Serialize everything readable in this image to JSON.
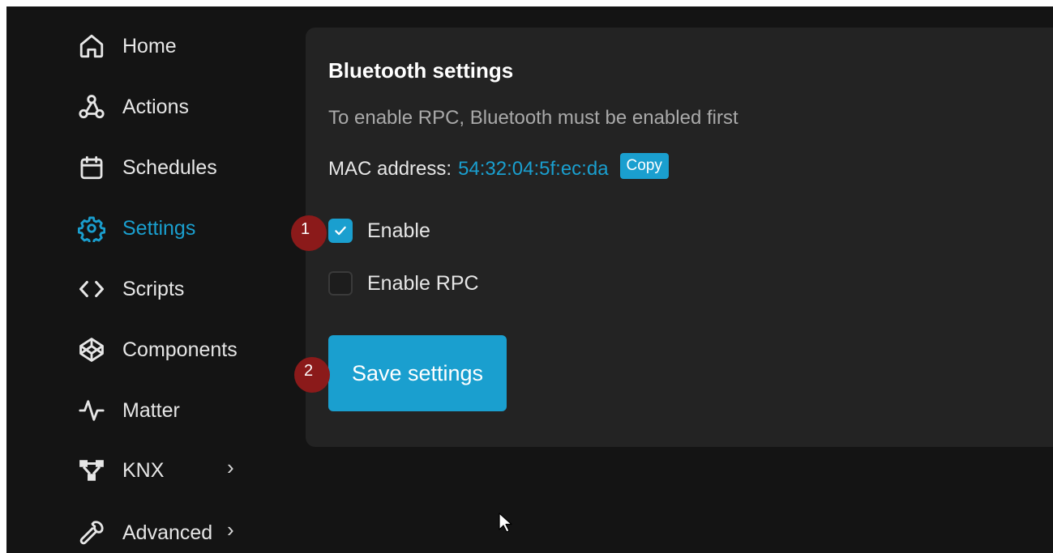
{
  "sidebar": {
    "items": [
      {
        "label": "Home",
        "icon": "home-icon"
      },
      {
        "label": "Actions",
        "icon": "webhook-icon"
      },
      {
        "label": "Schedules",
        "icon": "calendar-icon"
      },
      {
        "label": "Settings",
        "icon": "gear-icon",
        "active": true
      },
      {
        "label": "Scripts",
        "icon": "code-icon"
      },
      {
        "label": "Components",
        "icon": "codepen-icon"
      },
      {
        "label": "Matter",
        "icon": "pulse-icon"
      },
      {
        "label": "KNX",
        "icon": "network-icon",
        "has_submenu": true
      },
      {
        "label": "Advanced",
        "icon": "wrench-icon",
        "has_submenu": true
      }
    ]
  },
  "card": {
    "title": "Bluetooth settings",
    "description": "To enable RPC, Bluetooth must be enabled first",
    "mac_label": "MAC address:",
    "mac_value": "54:32:04:5f:ec:da",
    "copy_label": "Copy",
    "checkboxes": [
      {
        "label": "Enable",
        "checked": true
      },
      {
        "label": "Enable RPC",
        "checked": false
      }
    ],
    "save_label": "Save settings"
  },
  "annotations": {
    "badge_1": "1",
    "badge_2": "2"
  },
  "colors": {
    "accent": "#1a9fcf",
    "background": "#141414",
    "card": "#232323",
    "badge": "#8b1a1a"
  }
}
